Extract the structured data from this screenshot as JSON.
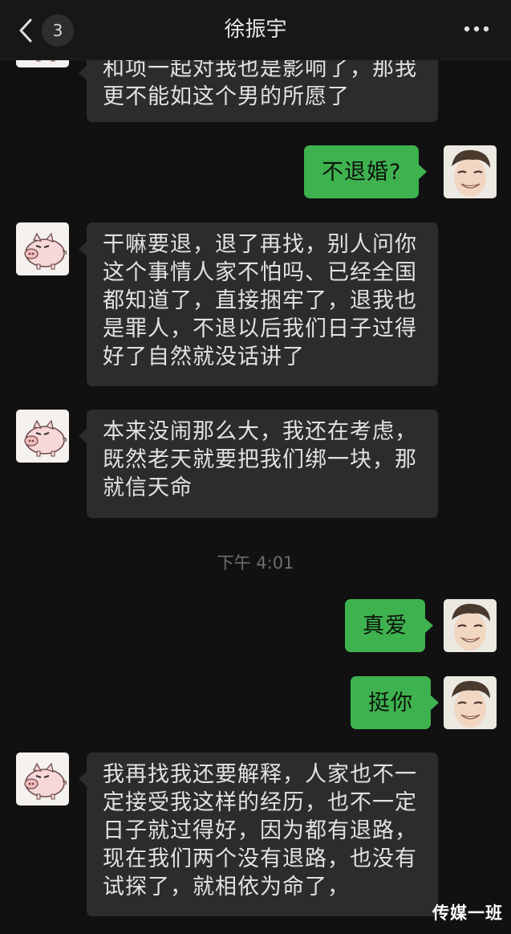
{
  "header": {
    "unread_count": "3",
    "title": "徐振宇"
  },
  "messages": [
    {
      "side": "in",
      "lines": [
        "和项一起对我也是影响了，那我",
        "更不能如这个男的所愿了"
      ]
    },
    {
      "side": "out",
      "lines": [
        "不退婚?"
      ]
    },
    {
      "side": "in",
      "lines": [
        "干嘛要退，退了再找，别人问你",
        "这个事情人家不怕吗、已经全国",
        "都知道了，直接捆牢了，退我也",
        "是罪人，不退以后我们日子过得",
        "好了自然就没话讲了"
      ]
    },
    {
      "side": "in",
      "lines": [
        "本来没闹那么大，我还在考虑，",
        "既然老天就要把我们绑一块，那",
        "就信天命"
      ]
    },
    {
      "side": "out",
      "lines": [
        "真爱"
      ]
    },
    {
      "side": "out",
      "lines": [
        "挺你"
      ]
    },
    {
      "side": "in",
      "lines": [
        "我再找我还要解释，人家也不一",
        "定接受我这样的经历，也不一定",
        "日子就过得好，因为都有退路，",
        "现在我们两个没有退路，也没有",
        "试探了，就相依为命了，"
      ]
    }
  ],
  "timestamp": "下午 4:01",
  "watermark": "传媒一班",
  "icons": {
    "back": "chevron-left-icon",
    "more": "more-dots-icon",
    "contact_avatar": "pig-avatar",
    "self_avatar": "man-avatar"
  },
  "colors": {
    "background": "#111111",
    "incoming_bubble": "#2c2c2c",
    "outgoing_bubble": "#3eb24f",
    "timestamp": "#6e6e6e"
  }
}
